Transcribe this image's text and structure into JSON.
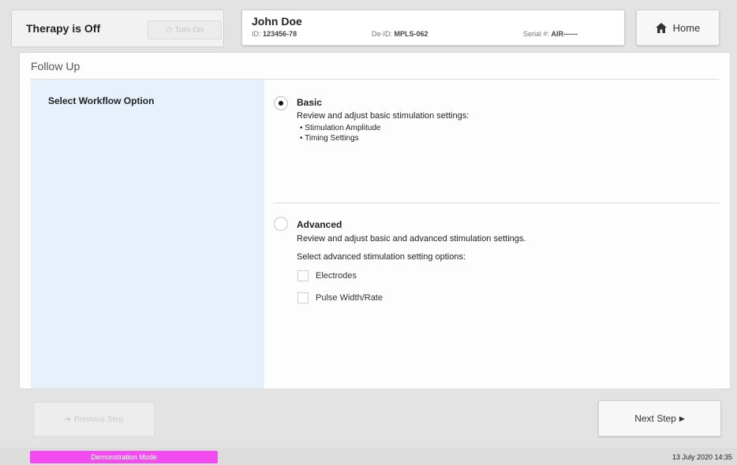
{
  "header": {
    "therapy_status": "Therapy is Off",
    "turn_on_label": "Turn On",
    "patient": {
      "name": "John Doe",
      "id_label": "ID:",
      "id_value": "123456-78",
      "deid_label": "De-ID:",
      "deid_value": "MPLS-062",
      "serial_label": "Serial #:",
      "serial_value": "AIR------"
    },
    "home_label": "Home"
  },
  "page": {
    "title": "Follow Up",
    "side_label": "Select Workflow Option"
  },
  "options": {
    "basic": {
      "title": "Basic",
      "selected": true,
      "desc": "Review and adjust basic stimulation settings:",
      "bullets": [
        "Stimulation Amplitude",
        "Timing Settings"
      ]
    },
    "advanced": {
      "title": "Advanced",
      "selected": false,
      "desc": "Review and adjust basic and advanced stimulation settings.",
      "sub_prompt": "Select advanced stimulation setting options:",
      "checkboxes": [
        {
          "label": "Electrodes",
          "checked": false
        },
        {
          "label": "Pulse Width/Rate",
          "checked": false
        }
      ]
    }
  },
  "footer": {
    "previous_label": "Previous Step",
    "next_label": "Next Step"
  },
  "status": {
    "mode": "Demonstration Mode",
    "datetime": "13 July 2020 14:35"
  },
  "colors": {
    "side_panel": "#e7f1fb",
    "demo_badge": "#f24bf0"
  }
}
